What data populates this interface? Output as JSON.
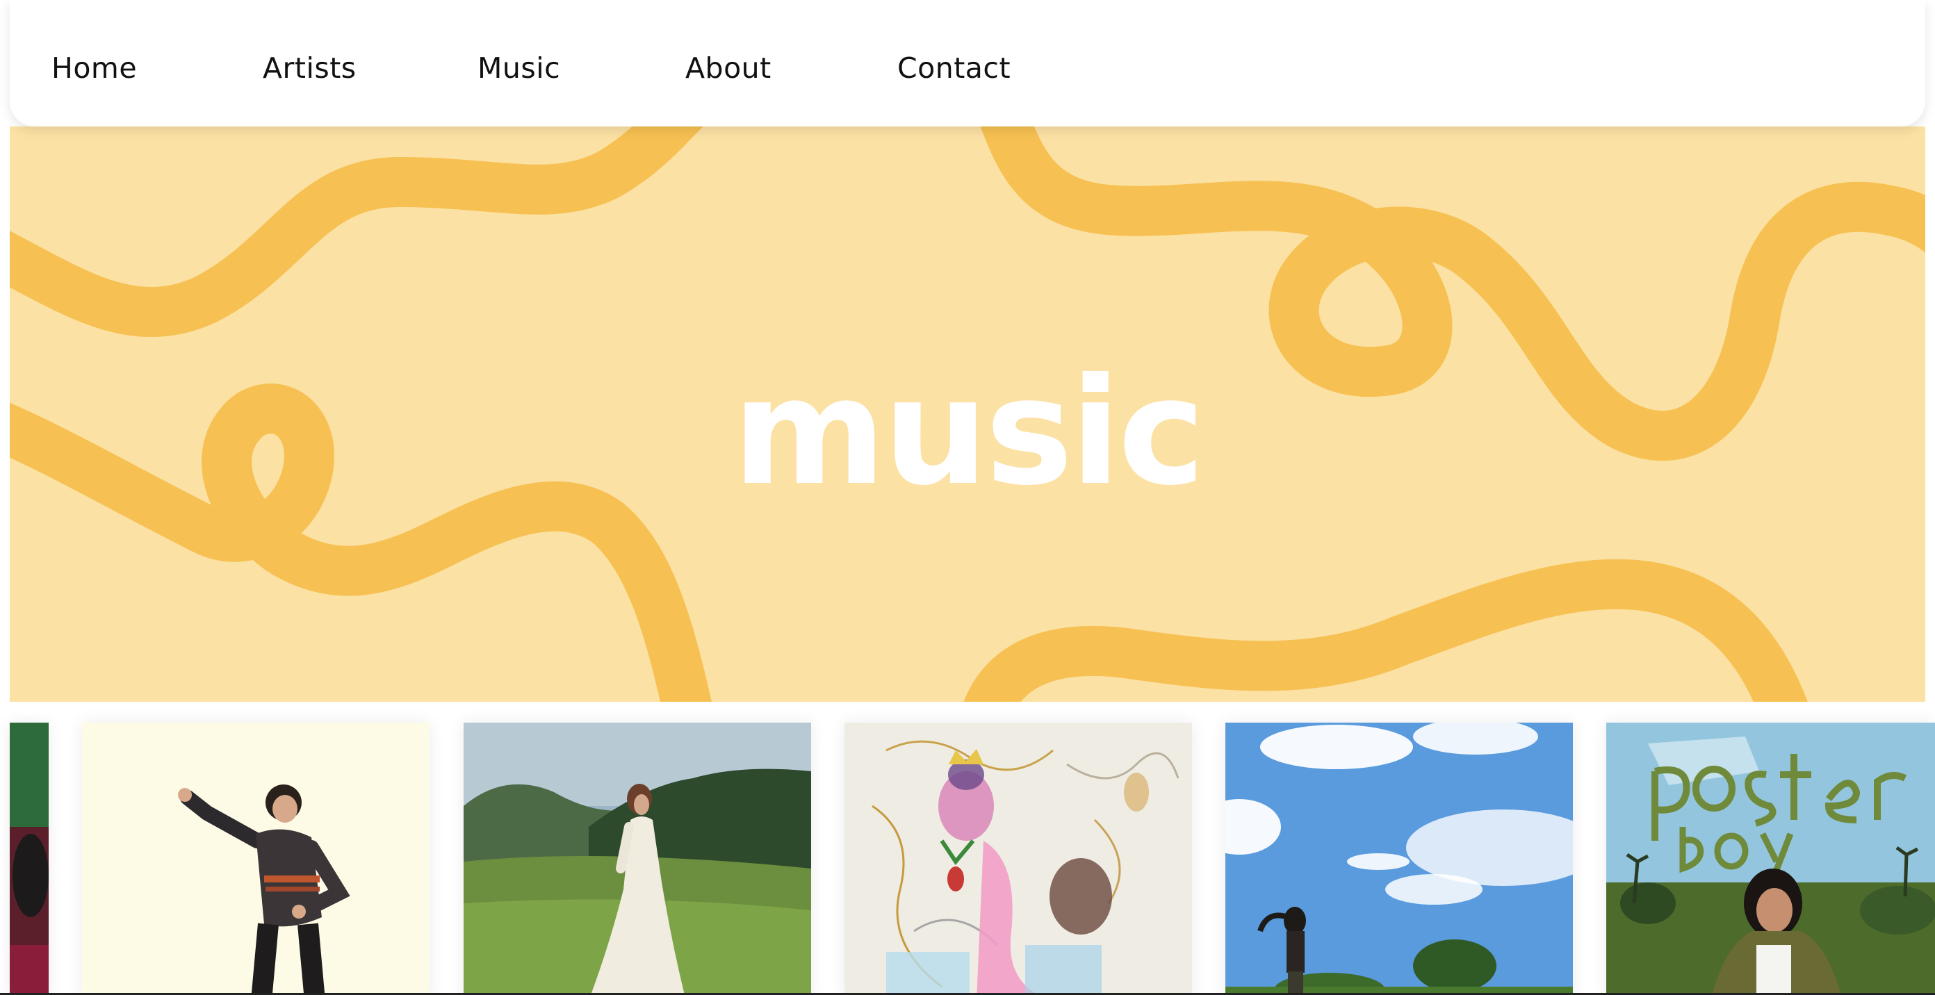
{
  "nav": {
    "items": [
      {
        "label": "Home"
      },
      {
        "label": "Artists"
      },
      {
        "label": "Music"
      },
      {
        "label": "About"
      },
      {
        "label": "Contact"
      }
    ]
  },
  "hero": {
    "title": "music",
    "background_color": "#fce1a4",
    "squiggle_color": "#f6c152",
    "title_color": "#ffffff"
  },
  "gallery": {
    "covers": [
      {
        "name": "partial-cover-left",
        "description_icon": "album-cover"
      },
      {
        "name": "cover-man-dancing",
        "description_icon": "album-cover"
      },
      {
        "name": "cover-woman-hillside",
        "description_icon": "album-cover"
      },
      {
        "name": "cover-drawing-collage",
        "description_icon": "album-cover"
      },
      {
        "name": "cover-woman-sky",
        "description_icon": "album-cover"
      },
      {
        "name": "cover-poster-boy",
        "description_icon": "album-cover",
        "lettering": "poster boy"
      }
    ]
  }
}
